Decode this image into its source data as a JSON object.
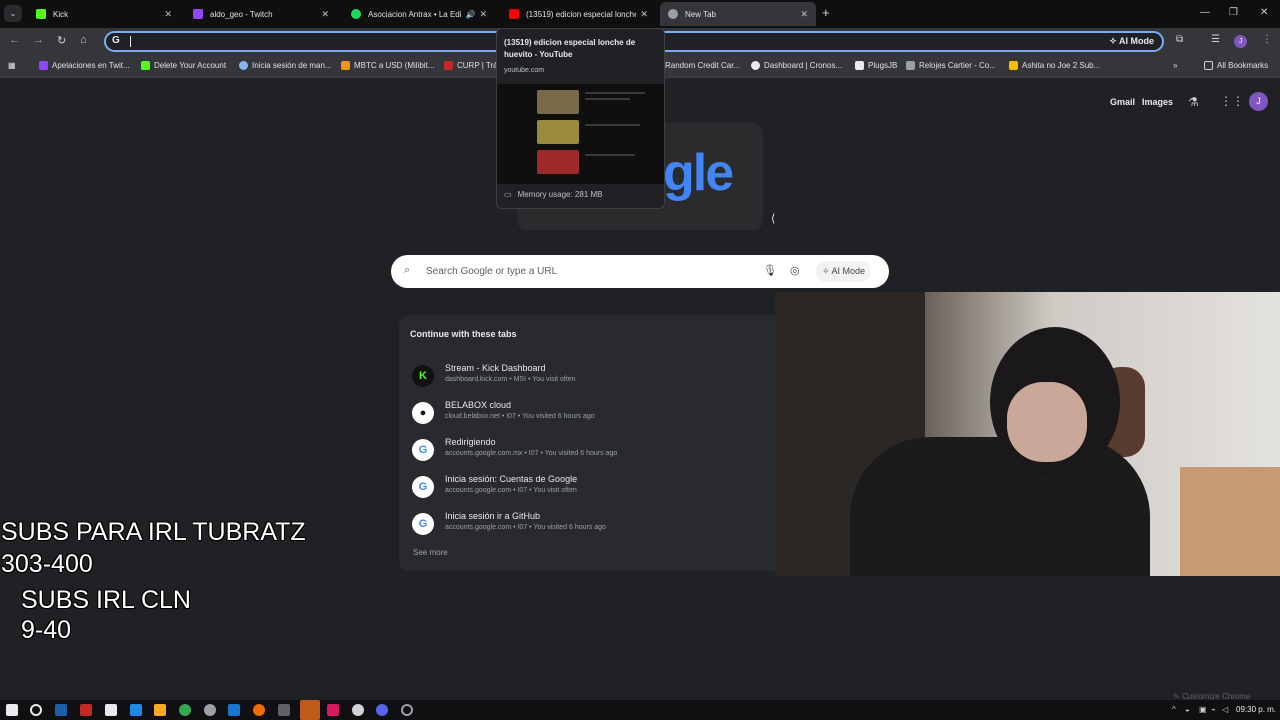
{
  "tabs": [
    {
      "title": "Kick",
      "color": "#53fc18"
    },
    {
      "title": "aldo_geo - Twitch",
      "color": "#9146ff"
    },
    {
      "title": "Asociacion Antrax • La Edic",
      "color": "#1ed760"
    },
    {
      "title": "(13519) edicion especial lonche",
      "color": "#ff0000"
    },
    {
      "title": "New Tab",
      "color": "#9aa0a6"
    }
  ],
  "toolbar": {
    "omnibox_icon": "G",
    "ai_mode": "AI Mode",
    "profile_initial": "J"
  },
  "bookmarks": [
    {
      "label": "Apelaciones en Twit...",
      "color": "#9146ff"
    },
    {
      "label": "Delete Your Account",
      "color": "#53fc18"
    },
    {
      "label": "Inicia sesión de man...",
      "color": "#8ab4f8"
    },
    {
      "label": "MBTC a USD (Milibit...",
      "color": "#f7931a"
    },
    {
      "label": "CURP | Trá...",
      "color": "#c62828"
    },
    {
      "label": "Random Credit Car...",
      "color": "#9aa0a6"
    },
    {
      "label": "Dashboard | Cronos...",
      "color": "#e8eaed"
    },
    {
      "label": "PlugsJB",
      "color": "#e8eaed"
    },
    {
      "label": "Relojes Cartier - Co...",
      "color": "#9aa0a6"
    },
    {
      "label": "Ashita no Joe 2 Sub...",
      "color": "#fbbc04"
    }
  ],
  "all_bookmarks": "All Bookmarks",
  "ntp": {
    "gmail": "Gmail",
    "images": "Images",
    "avatar_initial": "J",
    "logo_partial": "gle",
    "search_placeholder": "Search Google or type a URL",
    "ai_mode": "AI Mode"
  },
  "continue_tabs": {
    "title": "Continue with these tabs",
    "items": [
      {
        "icon": "K",
        "color": "#53fc18",
        "title": "Stream - Kick Dashboard",
        "meta": "dashboard.kick.com • MSI • You visit often"
      },
      {
        "icon": "GH",
        "color": "#ffffff",
        "title": "BELABOX cloud",
        "meta": "cloud.belabox.net • I07 • You visited 6 hours ago"
      },
      {
        "icon": "G",
        "color": "#4285f4",
        "title": "Redirigiendo",
        "meta": "accounts.google.com.mx • I07 • You visited 6 hours ago"
      },
      {
        "icon": "G",
        "color": "#4285f4",
        "title": "Inicia sesión: Cuentas de Google",
        "meta": "accounts.google.com • I07 • You visit often"
      },
      {
        "icon": "G",
        "color": "#4285f4",
        "title": "Inicia sesión ir a GitHub",
        "meta": "accounts.google.com • I07 • You visited 6 hours ago"
      }
    ],
    "see_more": "See more"
  },
  "hover_card": {
    "title": "(13519) edicion especial lonche de huevito - YouTube",
    "domain": "youtube.com",
    "memory": "Memory usage: 281 MB"
  },
  "overlay": {
    "line1": "SUBS PARA IRL TUBRATZ",
    "line2": "303-400",
    "line3": "SUBS IRL CLN",
    "line4": "9-40"
  },
  "customize": "Customize Chrome",
  "clock": "09:30 p. m."
}
